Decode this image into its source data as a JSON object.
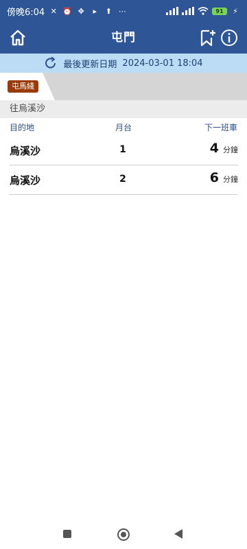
{
  "status_bar": {
    "time": "傍晚6:04",
    "battery": "91",
    "icons": [
      "alarm-icon",
      "signal-icon",
      "wifi-icon",
      "battery-icon"
    ]
  },
  "app_bar": {
    "title": "屯門",
    "icons": [
      "home-icon",
      "bookmark-add-icon",
      "info-icon"
    ]
  },
  "update": {
    "label": "最後更新日期",
    "datetime": "2024-03-01 18:04"
  },
  "line_tab": {
    "label": "屯馬綫",
    "color": "#9b3a09"
  },
  "direction": "往烏溪沙",
  "columns": {
    "destination": "目的地",
    "platform": "月台",
    "next_train": "下一班車"
  },
  "trains": [
    {
      "destination": "烏溪沙",
      "platform": "1",
      "minutes": "4",
      "unit": "分鐘"
    },
    {
      "destination": "烏溪沙",
      "platform": "2",
      "minutes": "6",
      "unit": "分鐘"
    }
  ],
  "colors": {
    "header": "#2e5596",
    "update_bar": "#bcdcf6",
    "line": "#9b3a09"
  }
}
